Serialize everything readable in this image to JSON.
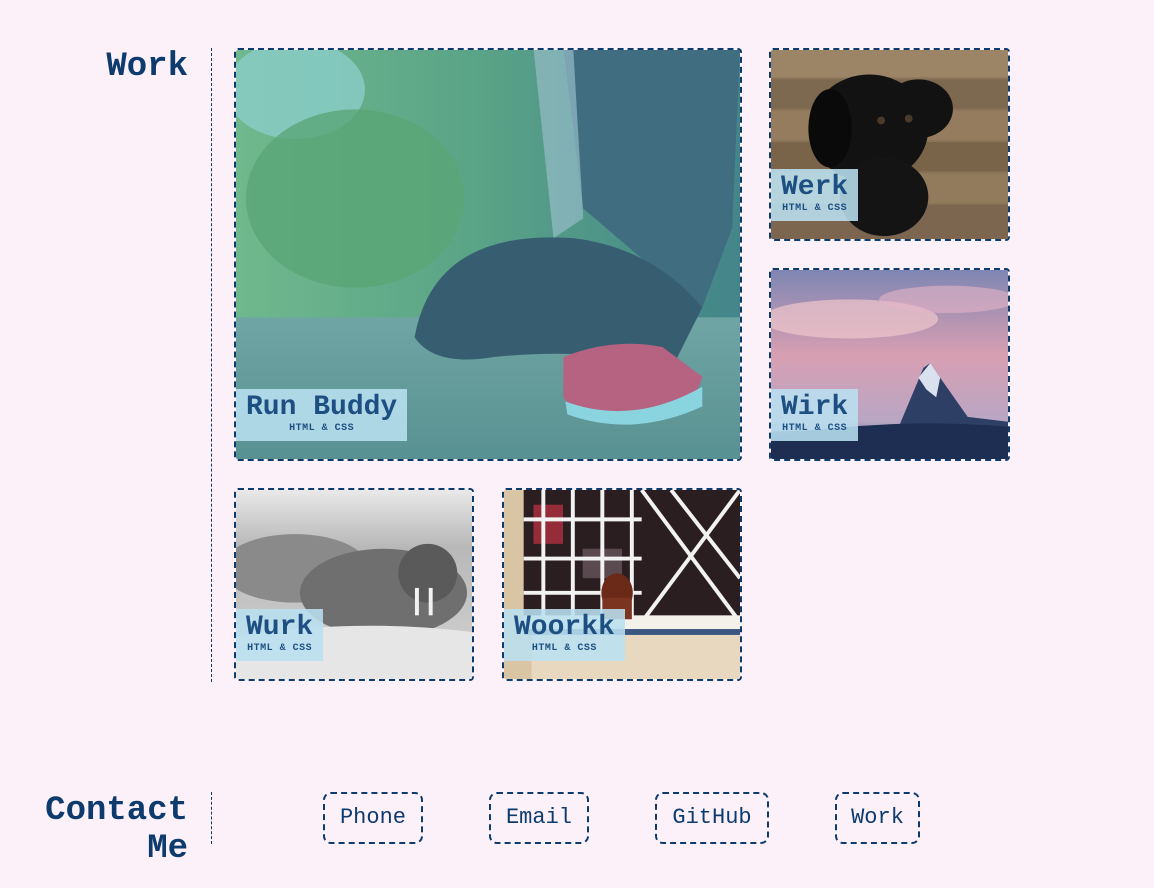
{
  "work": {
    "heading": "Work",
    "projects": [
      {
        "title": "Run Buddy",
        "subtitle": "HTML & CSS",
        "image_icon": "runner-tying-shoe-photo"
      },
      {
        "title": "Werk",
        "subtitle": "HTML & CSS",
        "image_icon": "black-puppy-photo"
      },
      {
        "title": "Wirk",
        "subtitle": "HTML & CSS",
        "image_icon": "mountain-sunset-photo"
      },
      {
        "title": "Wurk",
        "subtitle": "HTML & CSS",
        "image_icon": "walrus-photo"
      },
      {
        "title": "Woorkk",
        "subtitle": "HTML & CSS",
        "image_icon": "dog-behind-window-bars-photo"
      }
    ]
  },
  "contact": {
    "heading_line1": "Contact",
    "heading_line2": "Me",
    "links": [
      "Phone",
      "Email",
      "GitHub",
      "Work"
    ]
  },
  "colors": {
    "background": "#fdf1f9",
    "accent": "#0d3b6e",
    "label_bg": "#b9e0f0"
  }
}
